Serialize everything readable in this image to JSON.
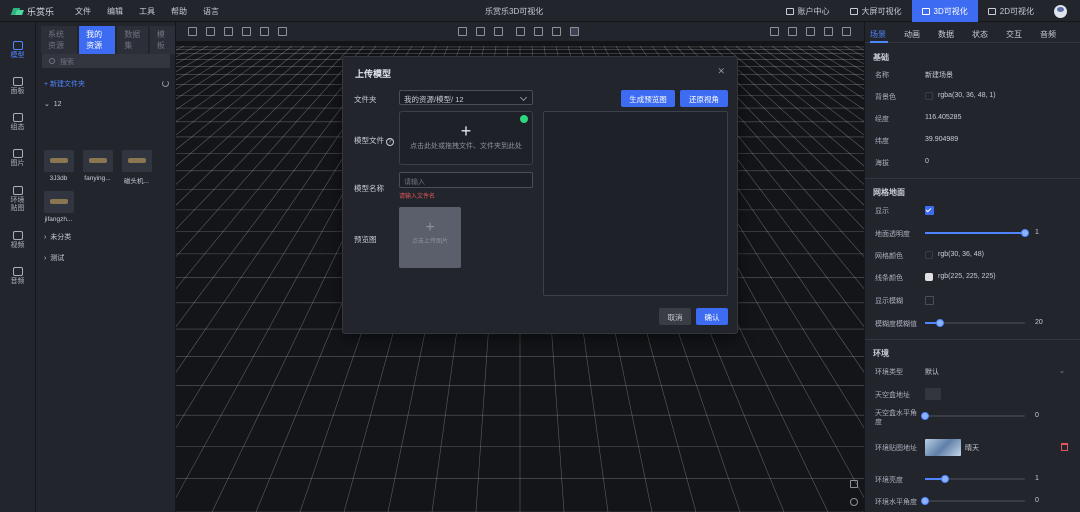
{
  "app": {
    "logo": "乐赏乐",
    "title": "乐赏乐3D可视化"
  },
  "menu": [
    "文件",
    "编辑",
    "工具",
    "帮助",
    "语言"
  ],
  "topnav": [
    {
      "label": "账户中心",
      "icon": "home-icon"
    },
    {
      "label": "大屏可视化",
      "icon": "monitor-icon"
    },
    {
      "label": "3D可视化",
      "icon": "cube-icon"
    },
    {
      "label": "2D可视化",
      "icon": "layers-icon"
    }
  ],
  "rail": [
    {
      "label": "模型",
      "icon": "cube-icon"
    },
    {
      "label": "面板",
      "icon": "panel-icon"
    },
    {
      "label": "组态",
      "icon": "nodes-icon"
    },
    {
      "label": "图片",
      "icon": "image-icon"
    },
    {
      "label": "环境贴图",
      "icon": "environment-icon"
    },
    {
      "label": "视频",
      "icon": "video-icon"
    },
    {
      "label": "音频",
      "icon": "audio-icon"
    }
  ],
  "resources": {
    "tabs": [
      "系统资源",
      "我的资源",
      "数据集",
      "模板"
    ],
    "search_placeholder": "搜索",
    "new_folder": "+ 新建文件夹",
    "folder_open": "12",
    "items": [
      "3J3db",
      "fanying...",
      "磁头机...",
      "jifangzh..."
    ],
    "folders": [
      "未分类",
      "测试"
    ]
  },
  "props": {
    "tabs": [
      "场景",
      "动画",
      "数据",
      "状态",
      "交互",
      "音频"
    ],
    "basic": {
      "title": "基础",
      "name_k": "名称",
      "name_v": "新建场景",
      "bg_k": "背景色",
      "bg_v": "rgba(30, 36, 48, 1)",
      "lng_k": "经度",
      "lng_v": "116.405285",
      "lat_k": "纬度",
      "lat_v": "39.904989",
      "alt_k": "海拔",
      "alt_v": "0"
    },
    "grid": {
      "title": "网格地面",
      "show_k": "显示",
      "opacity_k": "地面透明度",
      "opacity_v": "1",
      "opacity_frac": 1,
      "gridcolor_k": "网格颜色",
      "gridcolor_v": "rgb(30, 36, 48)",
      "linecolor_k": "线条颜色",
      "linecolor_v": "rgb(225, 225, 225)",
      "blur_k": "显示模糊",
      "blurval_k": "模糊度模糊值",
      "blurval_v": "20",
      "blurval_frac": 0.15
    },
    "env": {
      "title": "环境",
      "type_k": "环境类型",
      "type_v": "默认",
      "skybox_k": "天空盒地址",
      "skyangle_k": "天空盒水平角度",
      "skyangle_v": "0",
      "skyangle_frac": 0,
      "envmap_k": "环境贴图地址",
      "envmap_v": "晴天",
      "brightness_k": "环境亮度",
      "brightness_v": "1",
      "brightness_frac": 0.2,
      "envangle_k": "环境水平角度",
      "envangle_v": "0",
      "envangle_frac": 0
    }
  },
  "modal": {
    "title": "上传模型",
    "folder_k": "文件夹",
    "folder_v": "我的资源/模型/  12",
    "gen_preview": "生成预览图",
    "reset_view": "还原视角",
    "file_k": "模型文件",
    "drop_text": "点击此处或拖拽文件、文件夹到此处",
    "name_k": "模型名称",
    "name_placeholder": "请输入",
    "name_error": "请输入文件名",
    "preview_k": "预览图",
    "upload_img": "点击上传图片",
    "cancel": "取消",
    "ok": "确认"
  },
  "colors": {
    "accent": "#3d6cf2",
    "grid_color": "#1e2430",
    "line_color": "#e1e1e1"
  }
}
